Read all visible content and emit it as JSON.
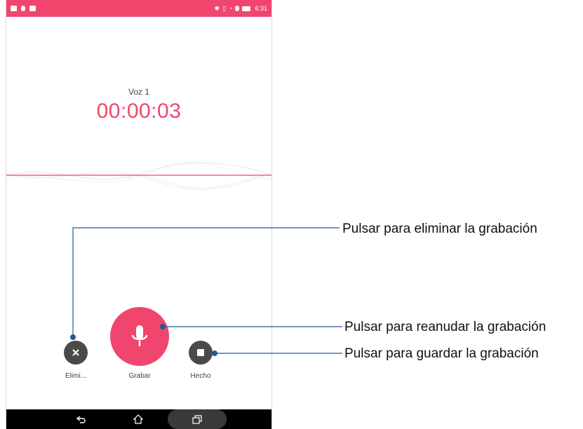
{
  "status_bar": {
    "time": "6:31",
    "left_icons": [
      "image-icon",
      "mic-icon",
      "gallery-icon"
    ],
    "right_icons": [
      "bluetooth-icon",
      "vibrate-icon",
      "wifi-icon",
      "sim-icon",
      "battery-icon"
    ]
  },
  "recording": {
    "name": "Voz 1",
    "timer": "00:00:03"
  },
  "controls": {
    "delete_label": "Elimi...",
    "record_label": "Grabar",
    "done_label": "Hecho"
  },
  "nav": {
    "back_icon": "back-icon",
    "home_icon": "home-icon",
    "recent_icon": "recent-apps-icon"
  },
  "callouts": {
    "delete": "Pulsar para eliminar la grabación",
    "resume": "Pulsar para reanudar la grabación",
    "save": "Pulsar para guardar la grabación"
  },
  "colors": {
    "accent": "#f0466e",
    "control_dark": "#4a4a4a",
    "callout_line": "#1f5a9a",
    "nav_bar": "#000000"
  }
}
